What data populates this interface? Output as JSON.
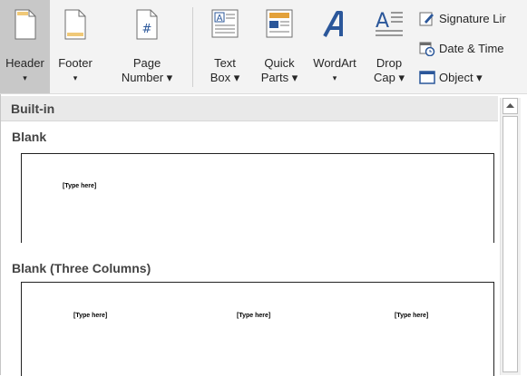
{
  "ribbon": {
    "header": {
      "line1": "Header",
      "line2": "▾"
    },
    "footer": {
      "line1": "Footer",
      "line2": "▾"
    },
    "page_number": {
      "line1": "Page",
      "line2": "Number ▾"
    },
    "text_box": {
      "line1": "Text",
      "line2": "Box ▾"
    },
    "quick_parts": {
      "line1": "Quick",
      "line2": "Parts ▾"
    },
    "wordart": {
      "line1": "WordArt",
      "line2": "▾"
    },
    "drop_cap": {
      "line1": "Drop",
      "line2": "Cap ▾"
    },
    "signature_line": "Signature Lir",
    "date_time": "Date & Time",
    "object": "Object  ▾"
  },
  "gallery": {
    "category": "Built-in",
    "items": [
      {
        "title": "Blank",
        "placeholders": [
          "[Type here]"
        ]
      },
      {
        "title": "Blank (Three Columns)",
        "placeholders": [
          "[Type here]",
          "[Type here]",
          "[Type here]"
        ]
      }
    ]
  },
  "colors": {
    "accent": "#2b579a",
    "selected": "#c8c8c8"
  }
}
